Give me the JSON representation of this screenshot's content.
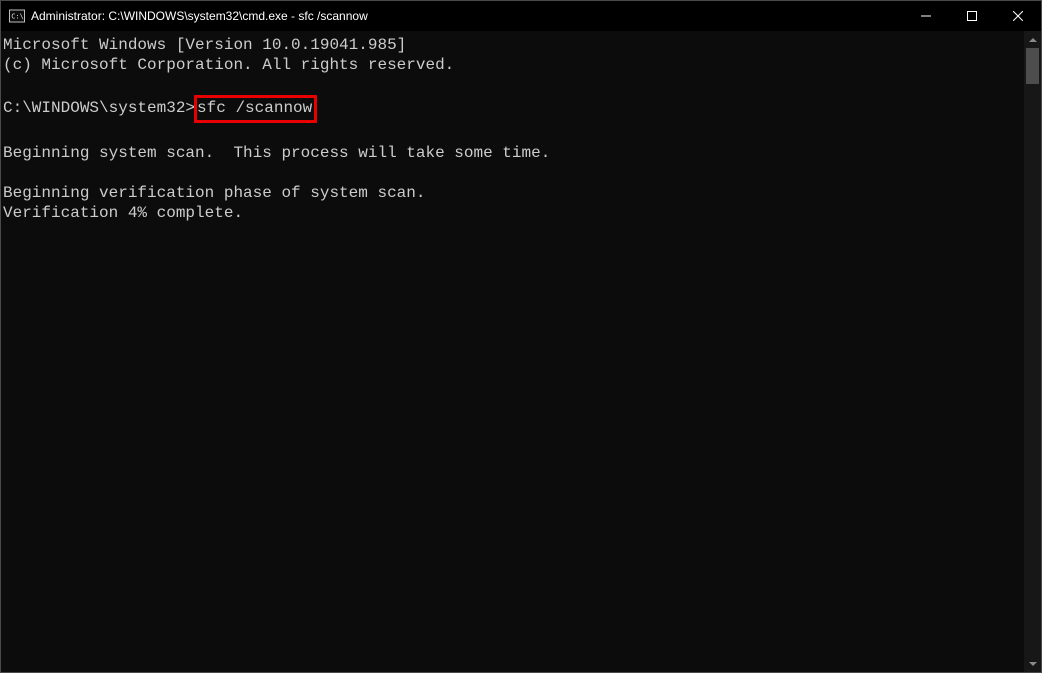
{
  "window": {
    "title": "Administrator: C:\\WINDOWS\\system32\\cmd.exe - sfc  /scannow"
  },
  "terminal": {
    "line1": "Microsoft Windows [Version 10.0.19041.985]",
    "line2": "(c) Microsoft Corporation. All rights reserved.",
    "blank1": "",
    "prompt": "C:\\WINDOWS\\system32>",
    "command": "sfc /scannow",
    "blank2": "",
    "line3": "Beginning system scan.  This process will take some time.",
    "blank3": "",
    "line4": "Beginning verification phase of system scan.",
    "line5": "Verification 4% complete."
  }
}
